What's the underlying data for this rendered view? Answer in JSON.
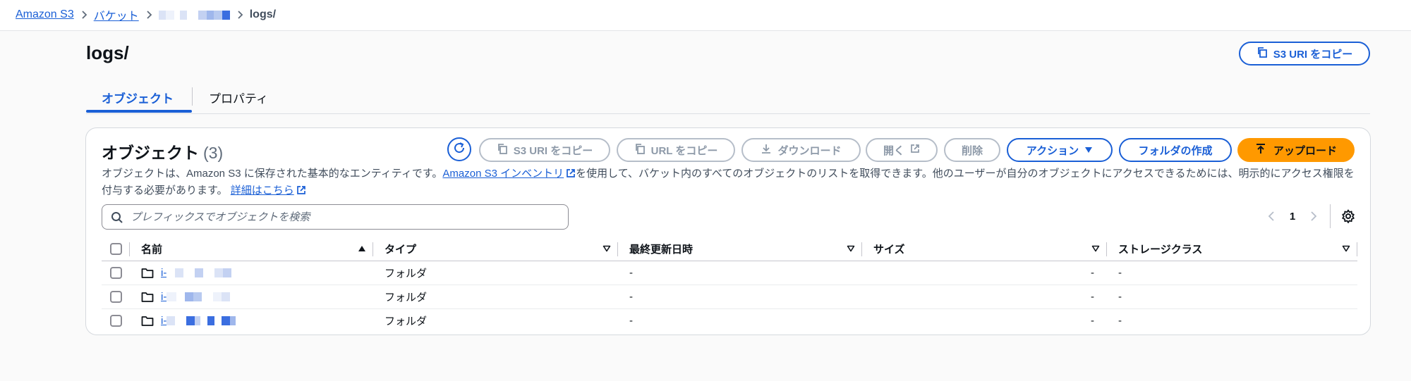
{
  "breadcrumb": {
    "items": [
      "Amazon S3",
      "バケット"
    ],
    "current": "logs/"
  },
  "page": {
    "title": "logs/",
    "copy_uri_label": "S3 URI をコピー"
  },
  "tabs": [
    {
      "label": "オブジェクト",
      "active": true
    },
    {
      "label": "プロパティ",
      "active": false
    }
  ],
  "objects_panel": {
    "title": "オブジェクト",
    "count": "(3)",
    "buttons": {
      "copy_s3_uri": "S3 URI をコピー",
      "copy_url": "URL をコピー",
      "download": "ダウンロード",
      "open": "開く",
      "delete": "削除",
      "actions": "アクション",
      "create_folder": "フォルダの作成",
      "upload": "アップロード"
    },
    "description": {
      "part1": "オブジェクトは、Amazon S3 に保存された基本的なエンティティです。",
      "link1": "Amazon S3 インベントリ",
      "part2": "を使用して、バケット内のすべてのオブジェクトのリストを取得できます。他のユーザーが自分のオブジェクトにアクセスできるためには、明示的にアクセス権限を付与する必要があります。",
      "link2": "詳細はこちら"
    },
    "search": {
      "placeholder": "プレフィックスでオブジェクトを検索",
      "value": ""
    },
    "pagination": {
      "current_page": "1"
    },
    "table": {
      "columns": [
        "名前",
        "タイプ",
        "最終更新日時",
        "サイズ",
        "ストレージクラス"
      ],
      "rows": [
        {
          "name": "i-",
          "type": "フォルダ",
          "last_modified": "-",
          "size": "-",
          "storage_class": "-"
        },
        {
          "name": "i-",
          "type": "フォルダ",
          "last_modified": "-",
          "size": "-",
          "storage_class": "-"
        },
        {
          "name": "i-",
          "type": "フォルダ",
          "last_modified": "-",
          "size": "-",
          "storage_class": "-"
        }
      ]
    }
  },
  "colors": {
    "link": "#1a5fd6",
    "primary_button": "#ff9900",
    "disabled": "#8d99a8",
    "redaction_light": "#dbe3f6",
    "redaction_dark": "#3b6ee0"
  }
}
